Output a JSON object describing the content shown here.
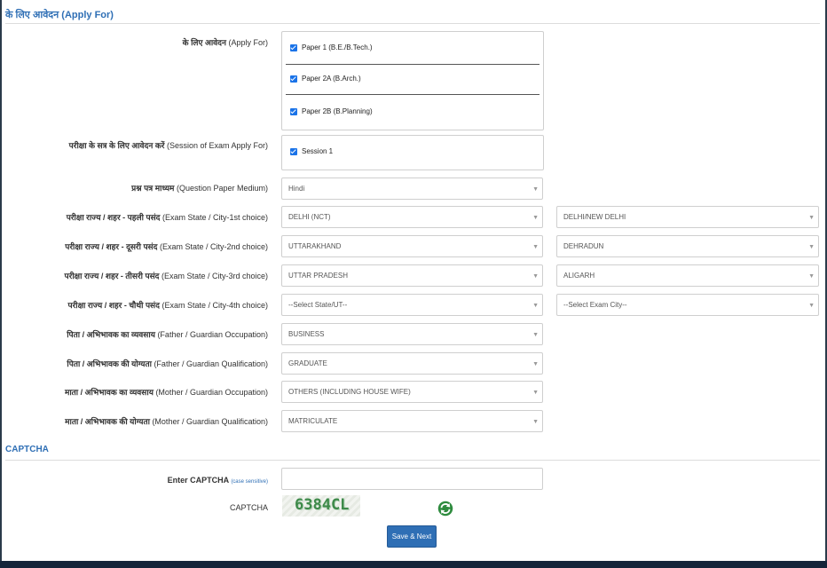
{
  "apply_section": {
    "title": "के लिए आवेदन (Apply For)",
    "apply_for": {
      "label_hi": "के लिए आवेदन",
      "label_en": "(Apply For)",
      "options": [
        {
          "label": "Paper 1 (B.E./B.Tech.)",
          "checked": true
        },
        {
          "label": "Paper 2A (B.Arch.)",
          "checked": true
        },
        {
          "label": "Paper 2B (B.Planning)",
          "checked": true
        }
      ]
    },
    "session": {
      "label_hi": "परीक्षा के सत्र के लिए आवेदन करें",
      "label_en": "(Session of Exam Apply For)",
      "options": [
        {
          "label": "Session 1",
          "checked": true
        }
      ]
    },
    "medium": {
      "label_hi": "प्रश्न पत्र माध्यम",
      "label_en": "(Question Paper Medium)",
      "value": "Hindi"
    },
    "city_choices": [
      {
        "label_hi": "परीक्षा राज्य / शहर - पहली पसंद",
        "label_en": "(Exam State / City-1st choice)",
        "state": "DELHI (NCT)",
        "city": "DELHI/NEW DELHI"
      },
      {
        "label_hi": "परीक्षा राज्य / शहर - दूसरी पसंद",
        "label_en": "(Exam State / City-2nd choice)",
        "state": "UTTARAKHAND",
        "city": "DEHRADUN"
      },
      {
        "label_hi": "परीक्षा राज्य / शहर - तीसरी पसंद",
        "label_en": "(Exam State / City-3rd choice)",
        "state": "UTTAR PRADESH",
        "city": "ALIGARH"
      },
      {
        "label_hi": "परीक्षा राज्य / शहर - चौथी पसंद",
        "label_en": "(Exam State / City-4th choice)",
        "state": "--Select State/UT--",
        "city": "--Select Exam City--"
      }
    ],
    "parents": [
      {
        "label_hi": "पिता / अभिभावक का व्यवसाय",
        "label_en": "(Father / Guardian Occupation)",
        "value": "BUSINESS"
      },
      {
        "label_hi": "पिता / अभिभावक की योग्यता",
        "label_en": "(Father / Guardian Qualification)",
        "value": "GRADUATE"
      },
      {
        "label_hi": "माता / अभिभावक का व्यवसाय",
        "label_en": "(Mother / Guardian Occupation)",
        "value": "OTHERS (INCLUDING HOUSE WIFE)"
      },
      {
        "label_hi": "माता / अभिभावक की योग्यता",
        "label_en": "(Mother / Guardian Qualification)",
        "value": "MATRICULATE"
      }
    ]
  },
  "captcha_section": {
    "title": "CAPTCHA",
    "enter_label": "Enter CAPTCHA",
    "enter_hint": "(case sensitive)",
    "input_value": "",
    "captcha_label": "CAPTCHA",
    "captcha_code": "6384CL",
    "refresh_icon": "refresh-icon"
  },
  "actions": {
    "save_label": "Save & Next"
  },
  "colors": {
    "accent": "#2f6fb5",
    "checkbox": "#1a73e8",
    "footer": "#14253a",
    "captcha_text": "#3e8a4a"
  }
}
